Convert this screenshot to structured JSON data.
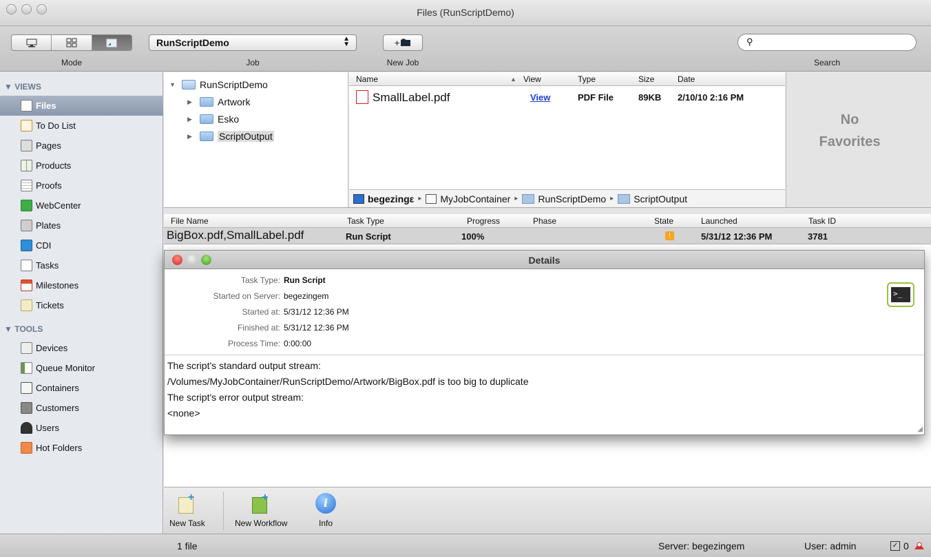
{
  "window": {
    "title": "Files (RunScriptDemo)"
  },
  "toolbar": {
    "mode_label": "Mode",
    "job_label": "Job",
    "job_value": "RunScriptDemo",
    "newjob_label": "New Job",
    "search_label": "Search",
    "search_value": ""
  },
  "sidebar": {
    "views_header": "VIEWS",
    "tools_header": "TOOLS",
    "views": [
      {
        "label": "Files",
        "icon": "file-icon"
      },
      {
        "label": "To Do List",
        "icon": "todo-icon"
      },
      {
        "label": "Pages",
        "icon": "pages-icon"
      },
      {
        "label": "Products",
        "icon": "products-icon"
      },
      {
        "label": "Proofs",
        "icon": "proofs-icon"
      },
      {
        "label": "WebCenter",
        "icon": "webcenter-icon"
      },
      {
        "label": "Plates",
        "icon": "plates-icon"
      },
      {
        "label": "CDI",
        "icon": "cdi-icon"
      },
      {
        "label": "Tasks",
        "icon": "tasks-icon"
      },
      {
        "label": "Milestones",
        "icon": "calendar-icon"
      },
      {
        "label": "Tickets",
        "icon": "tickets-icon"
      }
    ],
    "tools": [
      {
        "label": "Devices",
        "icon": "devices-icon"
      },
      {
        "label": "Queue Monitor",
        "icon": "queue-icon"
      },
      {
        "label": "Containers",
        "icon": "container-icon"
      },
      {
        "label": "Customers",
        "icon": "customers-icon"
      },
      {
        "label": "Users",
        "icon": "user-icon"
      },
      {
        "label": "Hot Folders",
        "icon": "hotfolder-icon"
      }
    ]
  },
  "tree": {
    "root": "RunScriptDemo",
    "children": [
      "Artwork",
      "Esko",
      "ScriptOutput"
    ]
  },
  "files": {
    "columns": {
      "name": "Name",
      "view": "View",
      "type": "Type",
      "size": "Size",
      "date": "Date"
    },
    "rows": [
      {
        "name": "SmallLabel.pdf",
        "view": "View",
        "type": "PDF File",
        "size": "89KB",
        "date": "2/10/10 2:16 PM"
      }
    ],
    "path": [
      "begezingε",
      "MyJobContainer",
      "RunScriptDemo",
      "ScriptOutput"
    ]
  },
  "favorites": {
    "line1": "No",
    "line2": "Favorites"
  },
  "tasks": {
    "columns": {
      "file": "File Name",
      "type": "Task Type",
      "progress": "Progress",
      "phase": "Phase",
      "state": "State",
      "launched": "Launched",
      "id": "Task ID"
    },
    "rows": [
      {
        "file": "BigBox.pdf,SmallLabel.pdf",
        "type": "Run Script",
        "progress": "100%",
        "phase": "",
        "state": "!",
        "launched": "5/31/12 12:36 PM",
        "id": "3781"
      }
    ]
  },
  "details": {
    "title": "Details",
    "fields": [
      {
        "key": "Task Type:",
        "value": "Run Script",
        "bold": true
      },
      {
        "key": "Started on Server:",
        "value": "begezingem"
      },
      {
        "key": "Started at:",
        "value": "5/31/12 12:36 PM"
      },
      {
        "key": "Finished at:",
        "value": "5/31/12 12:36 PM"
      },
      {
        "key": "Process Time:",
        "value": "0:00:00"
      }
    ],
    "output": [
      "The script's standard output stream:",
      "/Volumes/MyJobContainer/RunScriptDemo/Artwork/BigBox.pdf is too big to duplicate",
      "The script's error output stream:",
      "<none>"
    ]
  },
  "task_toolbar": {
    "new_task": "New Task",
    "new_workflow": "New Workflow",
    "info": "Info"
  },
  "status": {
    "count": "1 file",
    "server": "Server: begezingem",
    "user": "User: admin",
    "todo_count": "0"
  },
  "colors": {
    "sidebar_bg": "#e6e9ee",
    "selection": "#8b98ad",
    "link": "#1a3fd0",
    "warning": "#f6a623",
    "terminal_border": "#9bc13c"
  }
}
